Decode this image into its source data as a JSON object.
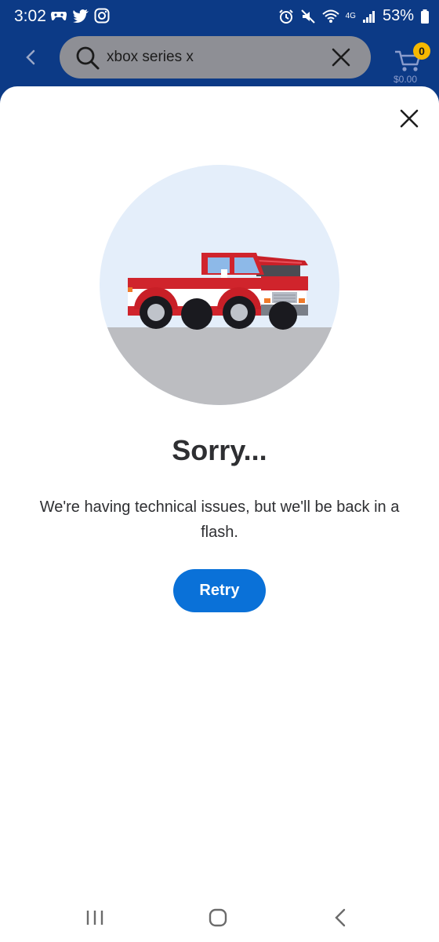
{
  "status_bar": {
    "time": "3:02",
    "battery": "53%",
    "network": "4G"
  },
  "search": {
    "query": "xbox series x"
  },
  "cart": {
    "count": "0",
    "total": "$0.00"
  },
  "error_dialog": {
    "title": "Sorry...",
    "message": "We're having technical issues, but we'll be back in a flash.",
    "retry_label": "Retry"
  },
  "colors": {
    "header_bg": "#0c3a86",
    "search_bg": "#8e8f95",
    "cart_badge": "#f5b800",
    "retry_button": "#0a71d8",
    "illustration_sky": "#e4eefa",
    "truck_red": "#d0242c"
  },
  "icons": {
    "back": "chevron-left-icon",
    "search": "search-icon",
    "clear": "close-icon",
    "cart": "cart-icon",
    "dialog_close": "close-icon",
    "nav_recents": "recents-icon",
    "nav_home": "home-icon",
    "nav_back": "back-icon"
  }
}
